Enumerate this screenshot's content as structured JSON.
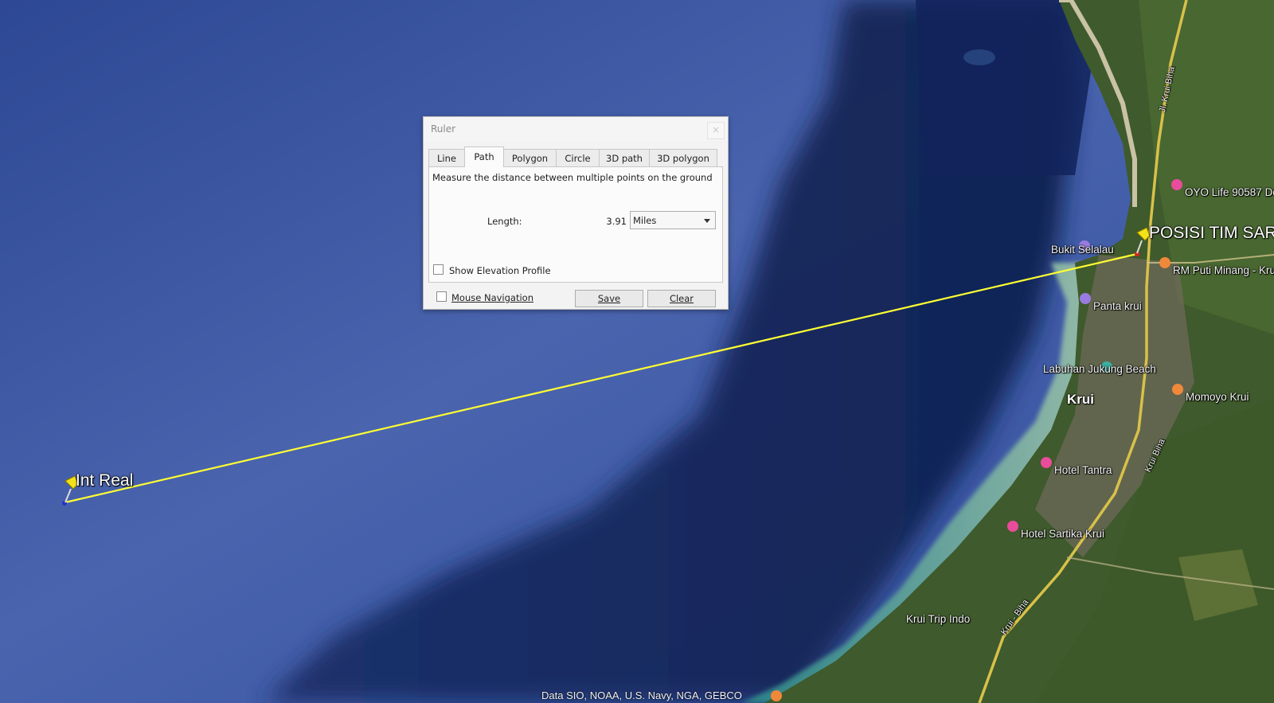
{
  "map": {
    "placemarks": [
      {
        "name": "Int Real"
      },
      {
        "name": "POSISI TIM SAR"
      }
    ],
    "places": [
      {
        "label": "OYO Life 90587 Do",
        "icon": "hotel-pin-icon"
      },
      {
        "label": "Bukit Selalau",
        "icon": "park-pin-icon"
      },
      {
        "label": "RM Puti Minang - Kru",
        "icon": "restaurant-pin-icon"
      },
      {
        "label": "Panta krui",
        "icon": "camera-pin-icon"
      },
      {
        "label": "Labuhan Jukung Beach",
        "icon": "beach-pin-icon"
      },
      {
        "label": "Momoyo Krui",
        "icon": "restaurant-pin-icon"
      },
      {
        "label": "Hotel Tantra",
        "icon": "hotel-pin-icon"
      },
      {
        "label": "Hotel Sartika Krui",
        "icon": "hotel-pin-icon"
      },
      {
        "label": "Krui Trip Indo",
        "icon": "place-pin-icon"
      }
    ],
    "town": "Krui",
    "roads": [
      "Jl. Krui Biha",
      "Krui Biha",
      "Krui - Biha"
    ],
    "attribution": "Data SIO, NOAA, U.S. Navy, NGA, GEBCO",
    "measure_line_color": "#ffff33",
    "pin_color": "#f2e21a"
  },
  "ruler": {
    "title": "Ruler",
    "close_label": "×",
    "tabs": [
      "Line",
      "Path",
      "Polygon",
      "Circle",
      "3D path",
      "3D polygon"
    ],
    "active_tab": "Path",
    "description": "Measure the distance between multiple points on the ground",
    "length_label": "Length:",
    "length_value": "3.91",
    "unit": "Miles",
    "show_elevation_label": "Show Elevation Profile",
    "mouse_nav_label": "Mouse Navigation",
    "save_label": "Save",
    "clear_label": "Clear"
  }
}
